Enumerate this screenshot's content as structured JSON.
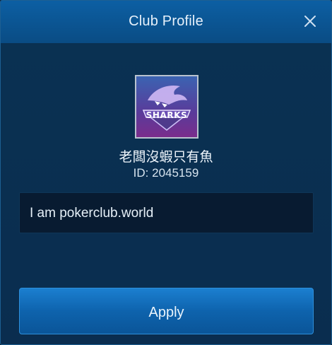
{
  "header": {
    "title": "Club Profile",
    "close_icon": "close-icon"
  },
  "club": {
    "logo_text": "SHARKS",
    "name": "老闆沒蝦只有魚",
    "id_label": "ID: 2045159"
  },
  "description": {
    "value": "I am pokerclub.world"
  },
  "actions": {
    "apply_label": "Apply"
  }
}
